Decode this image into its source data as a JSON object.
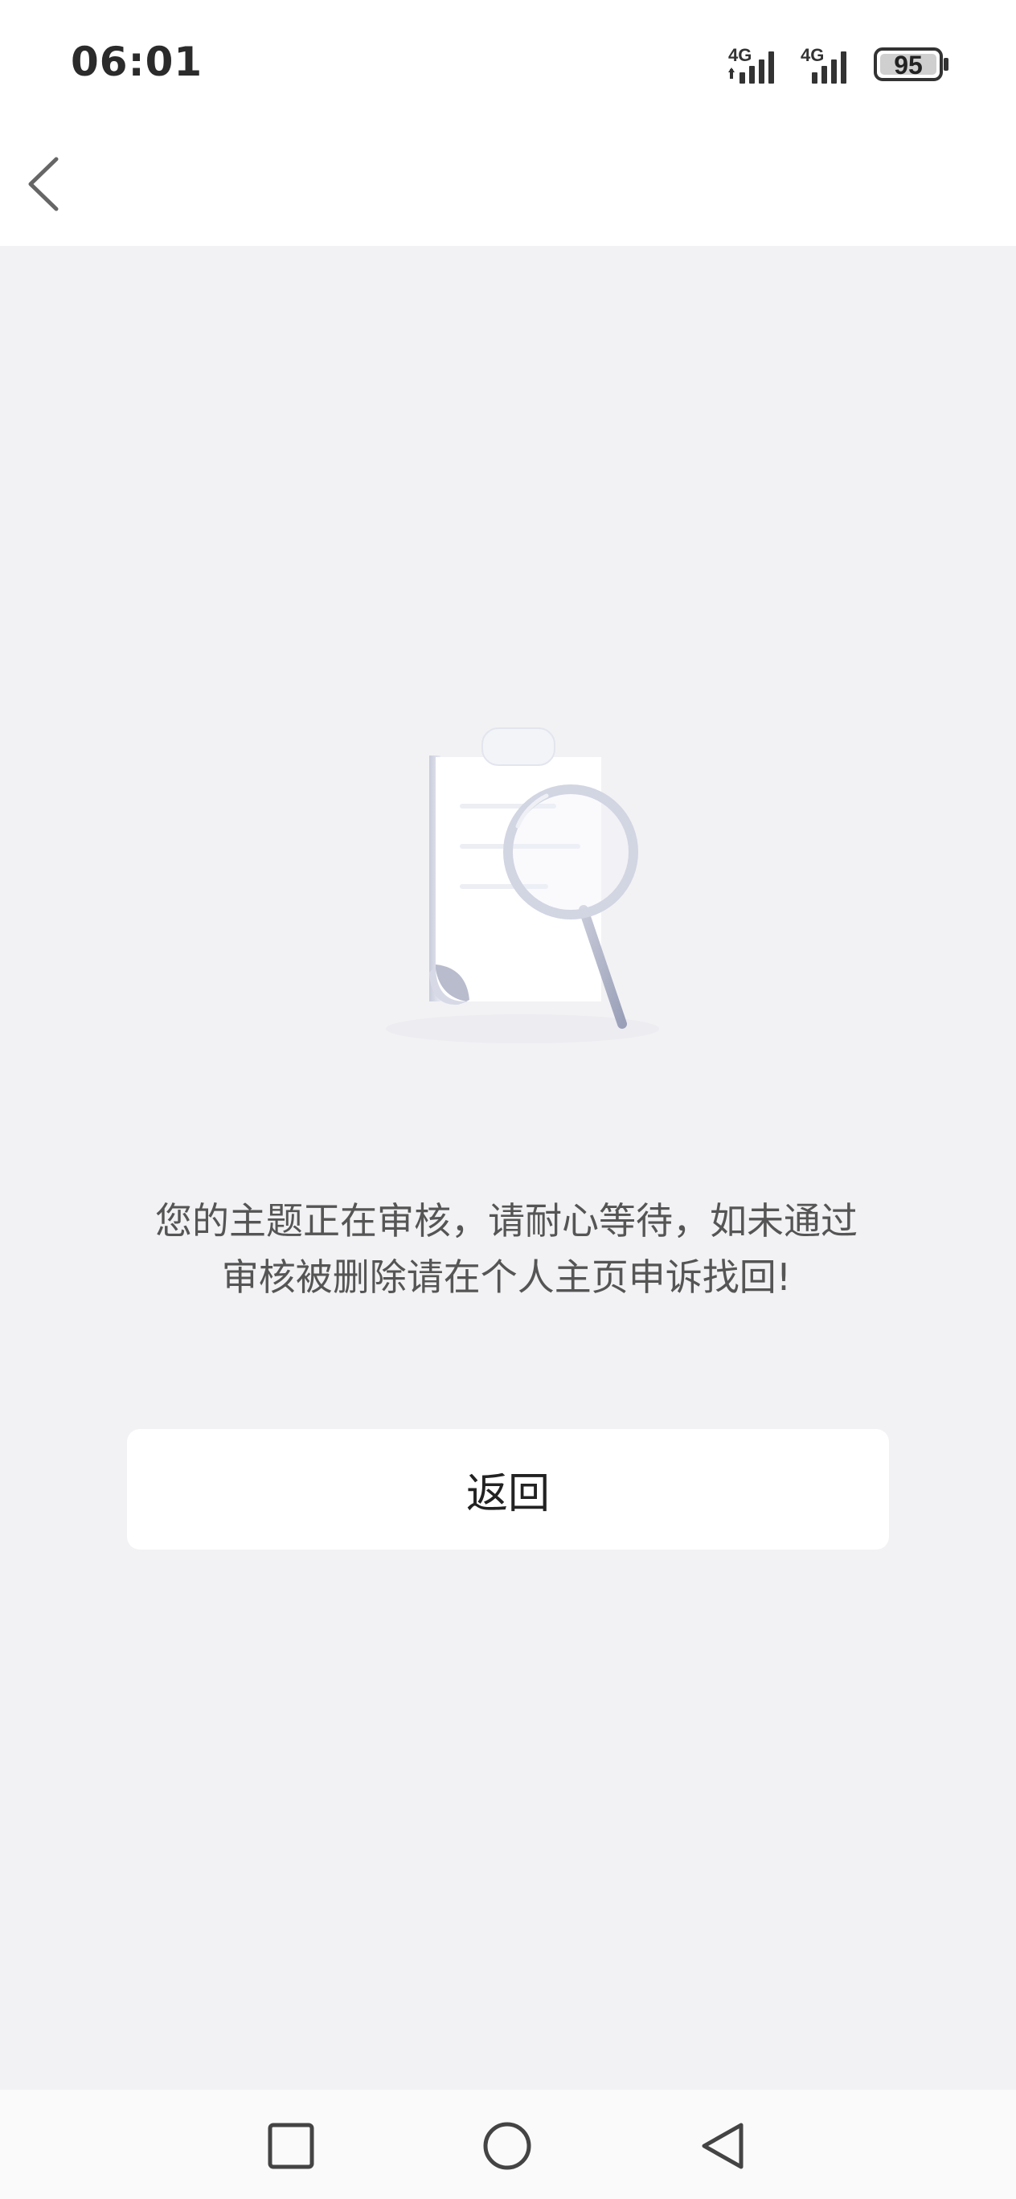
{
  "status_bar": {
    "time": "06:01",
    "signal_1_label": "4G",
    "signal_2_label": "4G",
    "battery_level": "95"
  },
  "app_bar": {
    "back_icon": "chevron-left-icon"
  },
  "main": {
    "illustration_icon": "document-review-magnifier-icon",
    "message": "您的主题正在审核，请耐心等待，如未通过审核被删除请在个人主页申诉找回!",
    "return_label": "返回"
  },
  "nav_bar": {
    "recents_icon": "square-icon",
    "home_icon": "circle-icon",
    "back_icon": "triangle-back-icon"
  },
  "colors": {
    "background": "#f2f2f4",
    "surface": "#ffffff",
    "text_primary": "#222222",
    "text_secondary": "#555555"
  }
}
